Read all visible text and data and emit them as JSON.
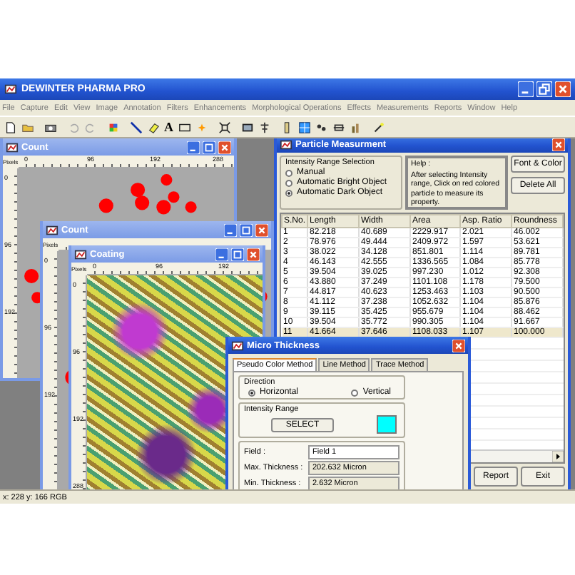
{
  "app": {
    "title": "DEWINTER PHARMA PRO"
  },
  "menu": [
    "File",
    "Capture",
    "Edit",
    "View",
    "Image",
    "Annotation",
    "Filters",
    "Enhancements",
    "Morphological Operations",
    "Effects",
    "Measurements",
    "Reports",
    "Window",
    "Help"
  ],
  "toolbar": {
    "text_tool": "A"
  },
  "image_windows": [
    {
      "title": "Count",
      "active": false,
      "unit": "Pixels",
      "x_ticks": [
        "0",
        "96",
        "192",
        "288"
      ],
      "y_ticks": [
        "0",
        "96",
        "192"
      ],
      "kind": "count"
    },
    {
      "title": "Count",
      "active": false,
      "unit": "Pixels",
      "y_ticks": [
        "0",
        "96",
        "192"
      ],
      "kind": "count"
    },
    {
      "title": "Coating",
      "active": false,
      "unit": "Pixels",
      "x_ticks": [
        "0",
        "96",
        "192"
      ],
      "y_ticks": [
        "0",
        "96",
        "192",
        "288"
      ],
      "kind": "photo"
    }
  ],
  "particle": {
    "title": "Particle Measurment",
    "active": true,
    "selection": {
      "label": "Intensity Range Selection",
      "options": [
        {
          "label": "Manual",
          "selected": false
        },
        {
          "label": "Automatic Bright Object",
          "selected": false
        },
        {
          "label": "Automatic Dark Object",
          "selected": true
        }
      ]
    },
    "help": {
      "title": "Help :",
      "text": "After selecting Intensity range, Click on red colored particle to measure its property."
    },
    "buttons": [
      "Font & Color",
      "Delete All"
    ],
    "columns": [
      "S.No.",
      "Length",
      "Width",
      "Area",
      "Asp. Ratio",
      "Roundness"
    ],
    "rows": [
      {
        "cells": [
          "1",
          "82.218",
          "40.689",
          "2229.917",
          "2.021",
          "46.002"
        ],
        "selected": false
      },
      {
        "cells": [
          "2",
          "78.976",
          "49.444",
          "2409.972",
          "1.597",
          "53.621"
        ],
        "selected": false
      },
      {
        "cells": [
          "3",
          "38.022",
          "34.128",
          "851.801",
          "1.114",
          "89.781"
        ],
        "selected": false
      },
      {
        "cells": [
          "4",
          "46.143",
          "42.555",
          "1336.565",
          "1.084",
          "85.778"
        ],
        "selected": false
      },
      {
        "cells": [
          "5",
          "39.504",
          "39.025",
          "997.230",
          "1.012",
          "92.308"
        ],
        "selected": false
      },
      {
        "cells": [
          "6",
          "43.880",
          "37.249",
          "1101.108",
          "1.178",
          "79.500"
        ],
        "selected": false
      },
      {
        "cells": [
          "7",
          "44.817",
          "40.623",
          "1253.463",
          "1.103",
          "90.500"
        ],
        "selected": false
      },
      {
        "cells": [
          "8",
          "41.112",
          "37.238",
          "1052.632",
          "1.104",
          "85.876"
        ],
        "selected": false
      },
      {
        "cells": [
          "9",
          "39.115",
          "35.425",
          "955.679",
          "1.104",
          "88.462"
        ],
        "selected": false
      },
      {
        "cells": [
          "10",
          "39.504",
          "35.772",
          "990.305",
          "1.104",
          "91.667"
        ],
        "selected": false
      },
      {
        "cells": [
          "11",
          "41.664",
          "37.646",
          "1108.033",
          "1.107",
          "100.000"
        ],
        "selected": true
      }
    ],
    "footer_buttons": [
      "Report",
      "Exit"
    ]
  },
  "micro": {
    "title": "Micro Thickness",
    "active": true,
    "tabs": [
      {
        "label": "Pseudo Color Method",
        "selected": true
      },
      {
        "label": "Line Method",
        "selected": false
      },
      {
        "label": "Trace Method",
        "selected": false
      }
    ],
    "direction": {
      "label": "Direction",
      "options": [
        {
          "label": "Horizontal",
          "selected": true
        },
        {
          "label": "Vertical",
          "selected": false
        }
      ]
    },
    "intensity": {
      "label": "Intensity Range",
      "button": "SELECT",
      "color": "#00ffff"
    },
    "fields": [
      {
        "label": "Field :",
        "value": "Field 1",
        "kind": "input"
      },
      {
        "label": "Max. Thickness :",
        "value": "202.632 Micron",
        "kind": "readonly"
      },
      {
        "label": "Min. Thickness :",
        "value": "2.632 Micron",
        "kind": "readonly"
      }
    ]
  },
  "status_bar": {
    "text": "x: 228 y: 166 RGB"
  }
}
